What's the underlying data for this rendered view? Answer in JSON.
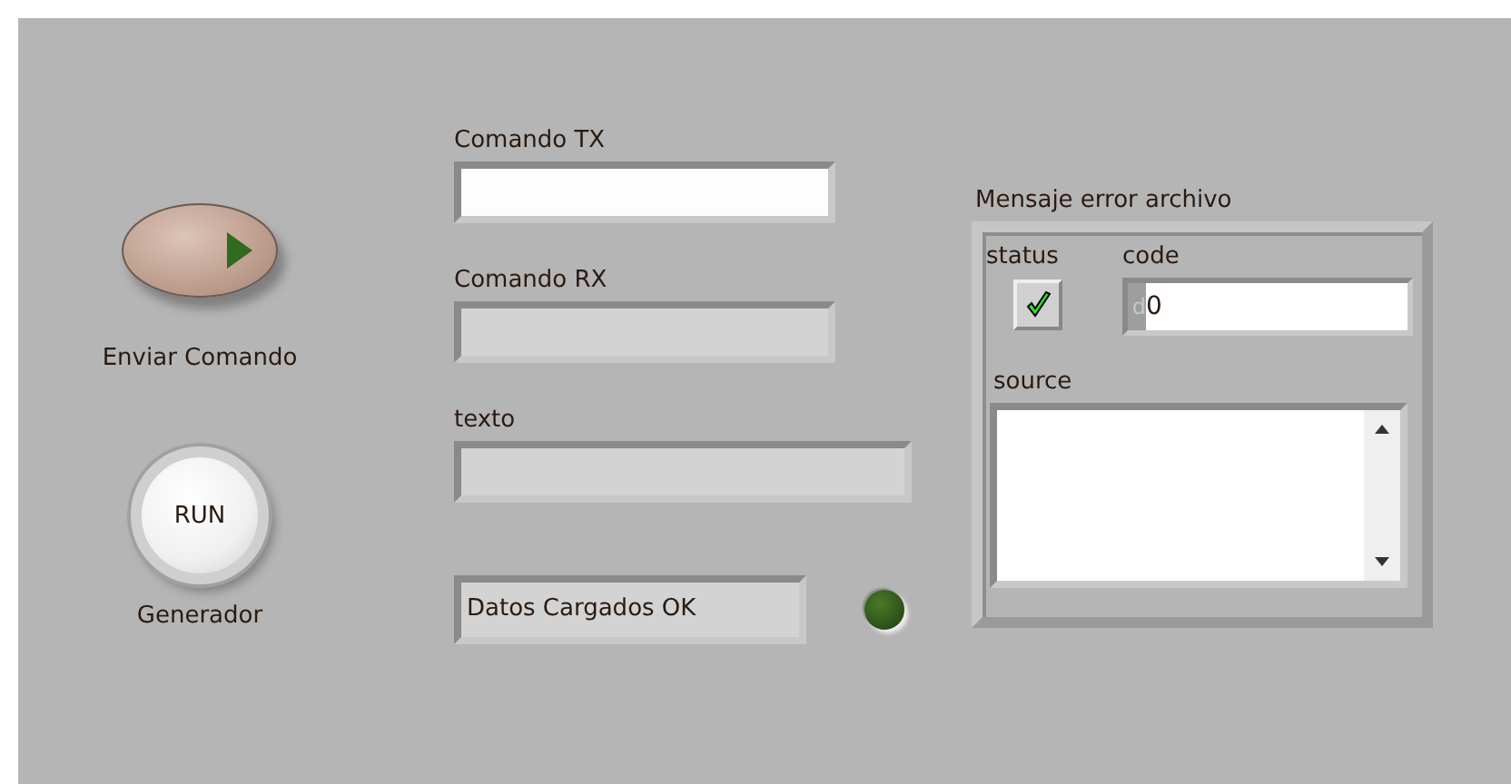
{
  "buttons": [
    {
      "label": "Enviar Comando",
      "kind": "play"
    },
    {
      "label": "Generador",
      "kind": "round",
      "text": "RUN"
    }
  ],
  "fields": [
    {
      "label": "Comando TX",
      "kind": "control"
    },
    {
      "label": "Comando RX",
      "kind": "indicator"
    },
    {
      "label": "texto",
      "kind": "indicator-wide"
    }
  ],
  "status_indicator": {
    "value": "Datos Cargados OK",
    "on": false
  },
  "error_cluster": {
    "title": "Mensaje error archivo",
    "status": {
      "label": "status",
      "checked": true
    },
    "code": {
      "label": "code",
      "radix": "d",
      "value": "0"
    },
    "source": {
      "label": "source"
    }
  }
}
